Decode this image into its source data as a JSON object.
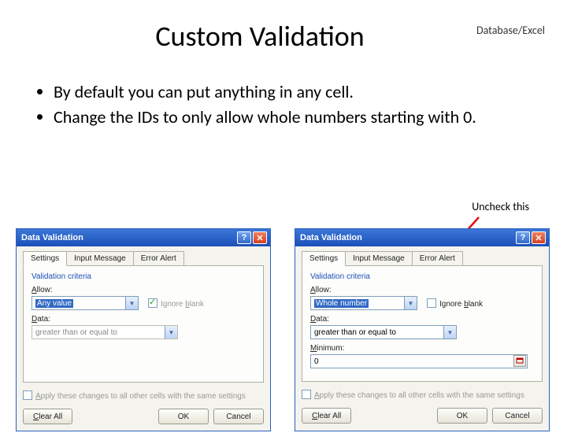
{
  "header": {
    "right": "Database/Excel"
  },
  "title": "Custom Validation",
  "bullets": [
    "By default you can put anything in any cell.",
    "Change the IDs to only allow whole numbers starting with 0."
  ],
  "annotation": "Uncheck this",
  "dialog": {
    "title": "Data Validation",
    "tabs": {
      "settings": "Settings",
      "input": "Input Message",
      "error": "Error Alert"
    },
    "section": "Validation criteria",
    "labels": {
      "allow": "Allow:",
      "data": "Data:",
      "minimum": "Minimum:"
    },
    "values": {
      "allow_any": "Any value",
      "allow_whole": "Whole number",
      "data_gte": "greater than or equal to",
      "min": "0"
    },
    "ignore_blank": "Ignore blank",
    "apply_all": "Apply these changes to all other cells with the same settings",
    "buttons": {
      "clear": "Clear All",
      "ok": "OK",
      "cancel": "Cancel"
    }
  }
}
